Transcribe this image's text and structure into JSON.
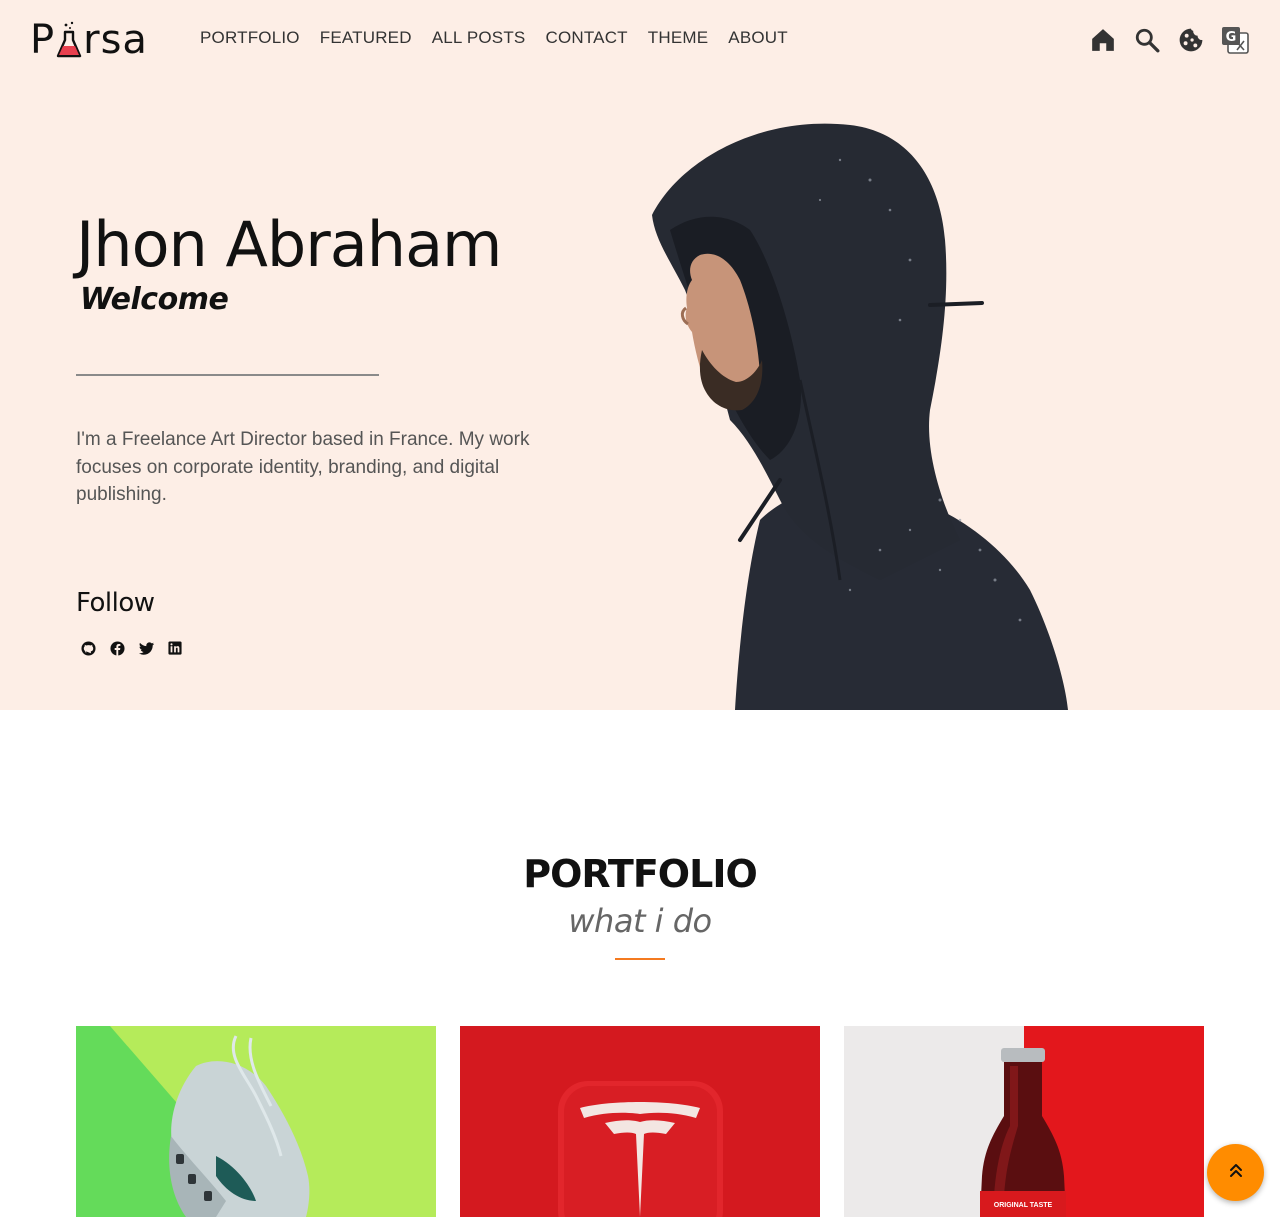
{
  "header": {
    "logo_left": "P",
    "logo_right": "rsa",
    "nav": [
      "PORTFOLIO",
      "FEATURED",
      "ALL POSTS",
      "CONTACT",
      "THEME",
      "ABOUT"
    ],
    "icons": [
      "home-icon",
      "search-icon",
      "cookie-icon",
      "translate-icon"
    ]
  },
  "hero": {
    "name": "Jhon Abraham",
    "subtitle": "Welcome",
    "description": "I'm a Freelance Art Director based in France. My work focuses on corporate identity, branding, and digital publishing.",
    "follow_label": "Follow",
    "socials": [
      "github-icon",
      "facebook-icon",
      "twitter-icon",
      "linkedin-icon"
    ]
  },
  "portfolio": {
    "title": "PORTFOLIO",
    "subtitle": "what i do",
    "accent_color": "#f47a20",
    "cards": [
      {
        "image": "sneaker-photo"
      },
      {
        "image": "tesla-logo-photo"
      },
      {
        "image": "cola-bottle-photo",
        "label": "ORIGINAL TASTE"
      }
    ]
  },
  "colors": {
    "hero_background": "#fdeee6",
    "scroll_top_button": "#ff8c00"
  }
}
